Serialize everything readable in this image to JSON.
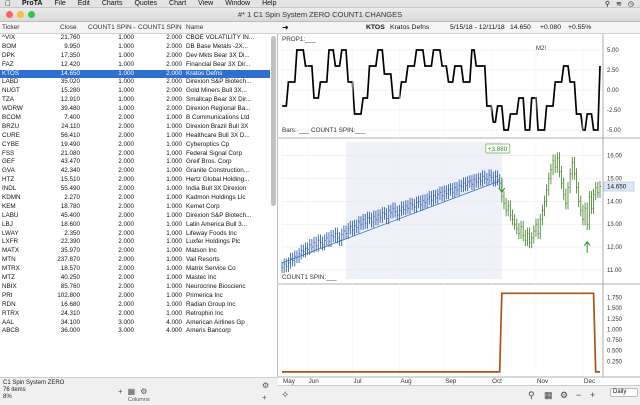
{
  "menubar": {
    "app": "ProTA",
    "items": [
      "File",
      "Edit",
      "Charts",
      "Quotes",
      "Chart",
      "View",
      "Window",
      "Help"
    ]
  },
  "window": {
    "title": "#* 1 C1 Spin System ZERO COUNT1 CHANGES"
  },
  "list": {
    "columns": [
      "Ticker",
      "Close",
      "COUNT1 SPIN←",
      "COUNT1 SPIN",
      "Name",
      "M2!"
    ],
    "rows": [
      [
        "^VIX",
        "21.760",
        "1.000",
        "2.000",
        "CBOE VOLATILITY IN..."
      ],
      [
        "BOM",
        "9.950",
        "1.000",
        "2.000",
        "DB Base Metals -2X..."
      ],
      [
        "DPK",
        "17.350",
        "1.000",
        "2.000",
        "Dev Mkts Bear 3X Di..."
      ],
      [
        "FAZ",
        "12.420",
        "1.000",
        "2.000",
        "Financial Bear 3X Dir..."
      ],
      [
        "KTOS",
        "14.650",
        "1.000",
        "2.000",
        "Kratos Defns"
      ],
      [
        "LABD",
        "35.020",
        "1.000",
        "2.000",
        "Direxion S&P Biotech..."
      ],
      [
        "NUGT",
        "15.280",
        "1.000",
        "2.000",
        "Gold Miners Bull 3X..."
      ],
      [
        "TZA",
        "12.910",
        "1.000",
        "2.000",
        "Smallcap Bear 3X Dir..."
      ],
      [
        "WDRW",
        "39.480",
        "1.000",
        "2.000",
        "Direxion Regional Ba..."
      ],
      [
        "BCOM",
        "7.400",
        "2.000",
        "1.000",
        "B Communications Ltd"
      ],
      [
        "BRZU",
        "24.110",
        "2.000",
        "1.000",
        "Direxion Brazil Bull 3X"
      ],
      [
        "CURE",
        "56.410",
        "2.000",
        "1.000",
        "Healthcare Bull 3X D..."
      ],
      [
        "CYBE",
        "19.490",
        "2.000",
        "1.000",
        "Cyberoptics Cp"
      ],
      [
        "FSS",
        "21.080",
        "2.000",
        "1.000",
        "Federal Signal Corp"
      ],
      [
        "GEF",
        "43.470",
        "2.000",
        "1.000",
        "Greif Bros. Corp"
      ],
      [
        "GVA",
        "42.340",
        "2.000",
        "1.000",
        "Granite Construction..."
      ],
      [
        "HTZ",
        "15.510",
        "2.000",
        "1.000",
        "Hertz Global Holding..."
      ],
      [
        "INDL",
        "55.490",
        "2.000",
        "1.000",
        "India Bull 3X Direxion"
      ],
      [
        "KDMN",
        "2.270",
        "2.000",
        "1.000",
        "Kadmon Holdings Llc"
      ],
      [
        "KEM",
        "18.780",
        "2.000",
        "1.000",
        "Kemet Corp"
      ],
      [
        "LABU",
        "45.400",
        "2.000",
        "1.000",
        "Direxion S&P Biotech..."
      ],
      [
        "LBJ",
        "18.600",
        "2.000",
        "1.000",
        "Latin America Bull 3..."
      ],
      [
        "LWAY",
        "2.350",
        "2.000",
        "1.000",
        "Lifeway Foods Inc"
      ],
      [
        "LXFR",
        "22.390",
        "2.000",
        "1.000",
        "Luxfer Holdings Plc"
      ],
      [
        "MATX",
        "35.970",
        "2.000",
        "1.000",
        "Matson Inc"
      ],
      [
        "MTN",
        "237.870",
        "2.000",
        "1.000",
        "Vail Resorts"
      ],
      [
        "MTRX",
        "18.570",
        "2.000",
        "1.000",
        "Matrix Service Co"
      ],
      [
        "MTZ",
        "40.250",
        "2.000",
        "1.000",
        "Mastec Inc"
      ],
      [
        "NBIX",
        "85.760",
        "2.000",
        "1.000",
        "Neurocrine Bioscienc"
      ],
      [
        "PRI",
        "102.800",
        "2.000",
        "1.000",
        "Primerica Inc"
      ],
      [
        "RDN",
        "16.680",
        "2.000",
        "1.000",
        "Radian Group Inc"
      ],
      [
        "RTRX",
        "24.310",
        "2.000",
        "1.000",
        "Retrophin Inc"
      ],
      [
        "AAL",
        "34.100",
        "3.000",
        "4.000",
        "American Airlines Gp"
      ],
      [
        "ABCB",
        "36.000",
        "3.000",
        "4.000",
        "Ameris Bancorp"
      ]
    ],
    "selected_index": 4,
    "footer": {
      "name": "C1 Spin System ZERO",
      "count": "76 items",
      "pct": "8%",
      "columns_label": "Columns"
    }
  },
  "chart": {
    "ticker": "KTOS",
    "name": "Kratos Defns",
    "range": "5/15/18 - 12/11/18",
    "last": "14.650",
    "change": "+0.080",
    "pct_change": "+0.55%",
    "m2_label": "M2!",
    "panel1_label": "PROP1:___",
    "panel2_label": "Bars:·___  COUNT1 SPIN:___",
    "panel3_label": "COUNT1 SPIN:___",
    "signal_label": "+3.880",
    "price_tag": "14.650",
    "frequency": "Daily",
    "months": [
      "May",
      "Jun",
      "Jul",
      "Aug",
      "Sep",
      "Oct",
      "Nov",
      "Dec"
    ],
    "year": "18"
  },
  "chart_data": [
    {
      "type": "line",
      "title": "PROP1",
      "yticks": [
        5.0,
        2.5,
        0.0,
        -2.5,
        -5.0
      ],
      "ylim": [
        -5.5,
        5.5
      ],
      "x": [
        0,
        2,
        3,
        6,
        7,
        10,
        11,
        14,
        15,
        17,
        18,
        21,
        22,
        24,
        25,
        27,
        28,
        30,
        31,
        33,
        34,
        37,
        38,
        40,
        41,
        44,
        45,
        47,
        48,
        51,
        52,
        55,
        56,
        58,
        59,
        62,
        63,
        66,
        67,
        70,
        71,
        74,
        75,
        77,
        78,
        80,
        81,
        84,
        85,
        88,
        89,
        90,
        91,
        95,
        96,
        98,
        99,
        100,
        101,
        103,
        104,
        106,
        107,
        110,
        111,
        113,
        114,
        116,
        117,
        119,
        120,
        123,
        124,
        127,
        128,
        131,
        132,
        134,
        135,
        137,
        138,
        140,
        141,
        142,
        143,
        145,
        146,
        148,
        149
      ],
      "values": [
        -2,
        -2,
        1,
        1,
        5,
        5,
        3,
        3,
        -1,
        -1,
        1,
        1,
        5,
        5,
        3,
        3,
        5,
        5,
        1,
        1,
        -3,
        -3,
        -1,
        -1,
        3,
        3,
        5,
        5,
        2,
        2,
        -1,
        -1,
        1,
        1,
        3,
        3,
        5,
        5,
        3,
        3,
        5,
        5,
        3,
        3,
        1,
        1,
        3,
        3,
        1,
        1,
        5,
        5,
        3,
        3,
        -2,
        -2,
        -4,
        -4,
        -2,
        -2,
        -5,
        -5,
        -3,
        -3,
        -1,
        -1,
        -5,
        -5,
        -1,
        -1,
        -5,
        -5,
        -2,
        -2,
        1,
        1,
        3,
        3,
        1,
        1,
        -3,
        -3,
        -5,
        -5,
        -3,
        -3,
        -5,
        -5,
        3
      ]
    },
    {
      "type": "ohlc",
      "title": "KTOS Bars",
      "yticks": [
        16.0,
        15.0,
        14.0,
        13.0,
        12.0,
        11.0
      ],
      "ylim": [
        10.6,
        16.6
      ],
      "trend_start": [
        0,
        11.3
      ],
      "trend_end": [
        102,
        14.9
      ],
      "signal_index": 103,
      "signal_value": 14.1,
      "up_arrow_index": 143,
      "last_close": 14.65,
      "close": [
        11.1,
        11.25,
        11.15,
        11.3,
        11.5,
        11.4,
        11.6,
        11.55,
        11.7,
        11.85,
        11.8,
        11.95,
        11.9,
        12.1,
        12.0,
        12.2,
        12.05,
        12.3,
        12.2,
        12.1,
        12.3,
        12.4,
        12.25,
        12.5,
        12.45,
        12.6,
        12.4,
        12.3,
        12.55,
        12.7,
        12.6,
        12.8,
        12.9,
        12.75,
        12.95,
        12.85,
        13.1,
        13.0,
        13.2,
        13.05,
        13.3,
        13.25,
        13.1,
        13.35,
        13.2,
        13.4,
        13.3,
        13.5,
        13.45,
        13.25,
        13.6,
        13.5,
        13.7,
        13.55,
        13.4,
        13.6,
        13.75,
        13.65,
        13.8,
        13.7,
        13.9,
        13.85,
        13.75,
        13.95,
        14.0,
        13.85,
        14.05,
        13.95,
        14.1,
        14.2,
        14.05,
        14.25,
        14.15,
        14.3,
        14.4,
        14.25,
        14.45,
        14.35,
        14.5,
        14.55,
        14.4,
        14.6,
        14.5,
        14.7,
        14.65,
        14.8,
        14.7,
        14.85,
        14.9,
        14.75,
        14.95,
        14.85,
        15.0,
        14.9,
        15.1,
        15.0,
        14.95,
        15.15,
        15.05,
        14.9,
        15.1,
        14.95,
        14.8,
        14.2,
        13.9,
        13.6,
        13.8,
        13.4,
        13.2,
        13.0,
        12.8,
        12.6,
        12.9,
        12.5,
        12.3,
        12.6,
        12.2,
        12.4,
        12.7,
        13.0,
        12.6,
        13.2,
        13.6,
        14.0,
        14.5,
        15.0,
        15.4,
        15.8,
        15.5,
        15.9,
        15.3,
        14.8,
        14.3,
        13.9,
        14.6,
        15.2,
        15.7,
        15.2,
        14.6,
        14.0,
        13.6,
        13.2,
        13.7,
        13.0,
        14.2,
        13.7,
        14.3,
        14.6,
        14.4,
        14.65
      ]
    },
    {
      "type": "line",
      "title": "COUNT1 SPIN",
      "yticks": [
        1.75,
        1.5,
        1.25,
        1.0,
        0.75,
        0.5,
        0.25
      ],
      "ylim": [
        -0.05,
        1.95
      ],
      "x": [
        0,
        102,
        103,
        146,
        147,
        149
      ],
      "values": [
        0,
        0,
        1.85,
        1.85,
        0,
        0
      ]
    }
  ]
}
